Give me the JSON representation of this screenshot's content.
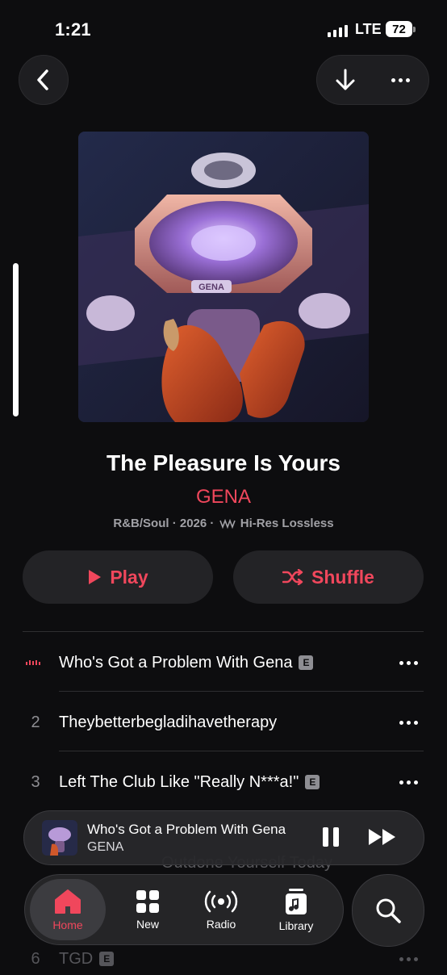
{
  "status_bar": {
    "time": "1:21",
    "network": "LTE",
    "battery": "72"
  },
  "nav": {
    "back_icon": "chevron-left-icon",
    "download_icon": "download-arrow-icon",
    "more_icon": "ellipsis-icon"
  },
  "album": {
    "title": "The Pleasure Is Yours",
    "artist": "GENA",
    "meta_prefix": "R&B/Soul · 2026 ·",
    "quality": "Hi-Res Lossless",
    "cover_text": "GENA"
  },
  "actions": {
    "play_label": "Play",
    "shuffle_label": "Shuffle"
  },
  "colors": {
    "accent": "#f0475c",
    "background": "#0d0d0f",
    "surface": "#232326"
  },
  "tracks": [
    {
      "number": "",
      "title": "Who's Got a Problem With Gena",
      "explicit": "E",
      "playing": true
    },
    {
      "number": "2",
      "title": "Theybetterbegladihavetherapy",
      "explicit": "",
      "playing": false
    },
    {
      "number": "3",
      "title": "Left The Club Like \"Really N***a!\"",
      "explicit": "E",
      "playing": false
    }
  ],
  "obscured_tracks": [
    {
      "title": "Outdone Yourself Today"
    },
    {
      "number": "6",
      "title": "TGD",
      "explicit": "E"
    }
  ],
  "mini_player": {
    "title": "Who's Got a Problem With Gena",
    "artist": "GENA"
  },
  "tabs": [
    {
      "label": "Home",
      "icon": "home-icon",
      "active": true
    },
    {
      "label": "New",
      "icon": "grid-icon",
      "active": false
    },
    {
      "label": "Radio",
      "icon": "radio-icon",
      "active": false
    },
    {
      "label": "Library",
      "icon": "library-icon",
      "active": false
    }
  ],
  "search_icon": "search-icon"
}
